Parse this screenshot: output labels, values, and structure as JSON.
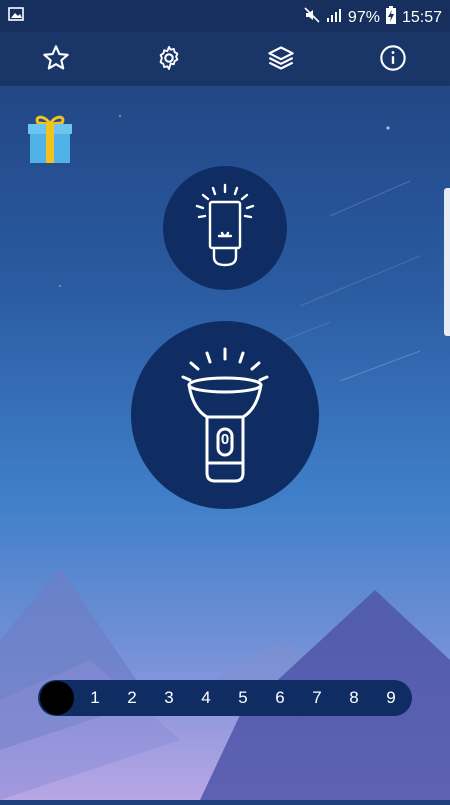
{
  "status_bar": {
    "battery_percent": "97%",
    "time": "15:57",
    "icons": [
      "image-icon",
      "mute-icon",
      "signal-icon",
      "battery-charging-icon"
    ]
  },
  "toolbar": {
    "buttons": [
      "star-icon",
      "gear-icon",
      "layers-icon",
      "info-icon"
    ]
  },
  "main": {
    "gift_icon": "gift-icon",
    "screen_light_button": "screen-light-icon",
    "flashlight_button": "flashlight-icon",
    "flashlight_button_label": "0"
  },
  "strobe": {
    "selected": 0,
    "numbers": [
      "1",
      "2",
      "3",
      "4",
      "5",
      "6",
      "7",
      "8",
      "9"
    ]
  },
  "colors": {
    "statusbar": "#162f5c",
    "toolbar": "#1a3669",
    "circle": "#0f2d63",
    "gift_box": "#4fb3e8",
    "gift_ribbon": "#f2c31f"
  }
}
